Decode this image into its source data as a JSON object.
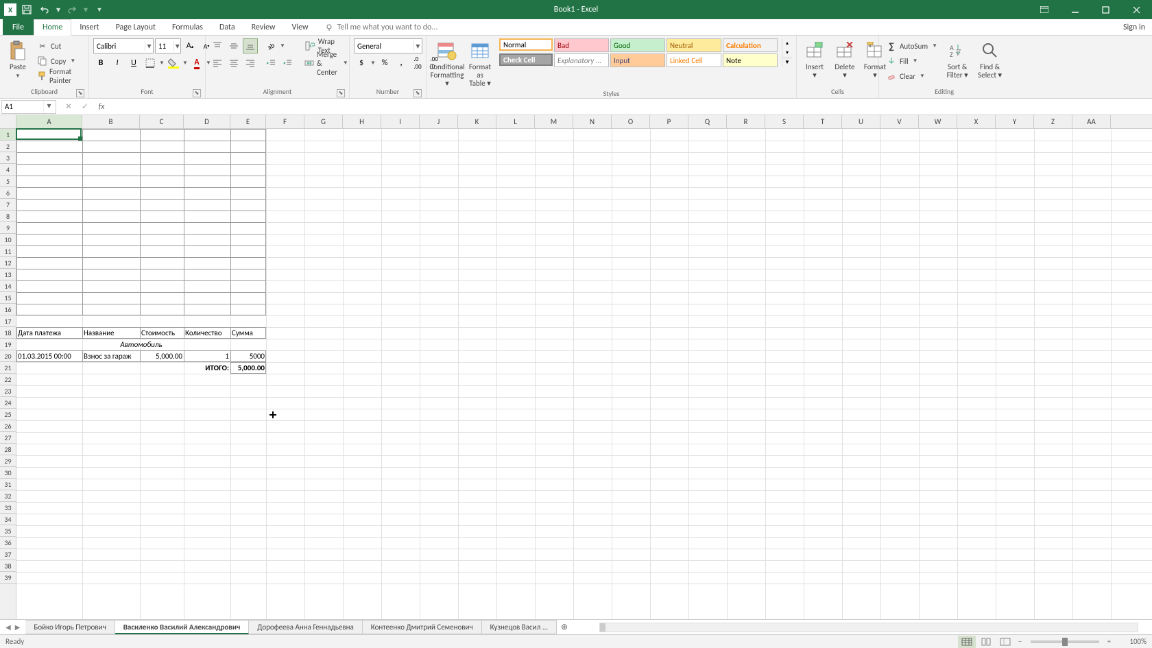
{
  "title": "Book1 - Excel",
  "signin": "Sign in",
  "tabs": {
    "file": "File",
    "home": "Home",
    "insert": "Insert",
    "pagelayout": "Page Layout",
    "formulas": "Formulas",
    "data": "Data",
    "review": "Review",
    "view": "View"
  },
  "tell_placeholder": "Tell me what you want to do...",
  "ribbon": {
    "clipboard": {
      "paste": "Paste",
      "cut": "Cut",
      "copy": "Copy",
      "painter": "Format Painter",
      "label": "Clipboard"
    },
    "font": {
      "name": "Calibri",
      "size": "11",
      "label": "Font"
    },
    "alignment": {
      "wrap": "Wrap Text",
      "merge": "Merge & Center",
      "label": "Alignment"
    },
    "number": {
      "format": "General",
      "label": "Number"
    },
    "styles": {
      "cond": "Conditional Formatting",
      "table": "Format as Table",
      "cells": {
        "normal": "Normal",
        "bad": "Bad",
        "good": "Good",
        "neutral": "Neutral",
        "calc": "Calculation",
        "check": "Check Cell",
        "expl": "Explanatory ...",
        "input": "Input",
        "linked": "Linked Cell",
        "note": "Note"
      },
      "label": "Styles"
    },
    "cells_grp": {
      "insert": "Insert",
      "delete": "Delete",
      "format": "Format",
      "label": "Cells"
    },
    "editing": {
      "autosum": "AutoSum",
      "fill": "Fill",
      "clear": "Clear",
      "sort": "Sort & Filter",
      "find": "Find & Select",
      "label": "Editing"
    }
  },
  "namebox": "A1",
  "columns": [
    "A",
    "B",
    "C",
    "D",
    "E",
    "F",
    "G",
    "H",
    "I",
    "J",
    "K",
    "L",
    "M",
    "N",
    "O",
    "P",
    "Q",
    "R",
    "S",
    "T",
    "U",
    "V",
    "W",
    "X",
    "Y",
    "Z",
    "AA"
  ],
  "col_widths": {
    "A": 96,
    "B": 84,
    "C": 64,
    "D": 68,
    "E": 52
  },
  "default_col_width": 56,
  "row_count": 39,
  "data_table": {
    "headers": {
      "A": "Дата платежа",
      "B": "Название",
      "C": "Стоимость",
      "D": "Количество",
      "E": "Сумма"
    },
    "category": "Автомобиль",
    "rows": [
      {
        "date": "01.03.2015 00:00",
        "name": "Взнос за гараж",
        "cost": "5,000.00",
        "qty": "1",
        "sum": "5000"
      }
    ],
    "total_label": "ИТОГО:",
    "total": "5,000.00"
  },
  "sheets": [
    "Бойко Игорь Петрович",
    "Василенко Василий Александрович",
    "Дорофеева Анна Геннадьевна",
    "Контеенко Дмитрий Семенович",
    "Кузнецов Васил  ..."
  ],
  "active_sheet_index": 1,
  "status": "Ready",
  "zoom": "100%",
  "chart_data": null
}
